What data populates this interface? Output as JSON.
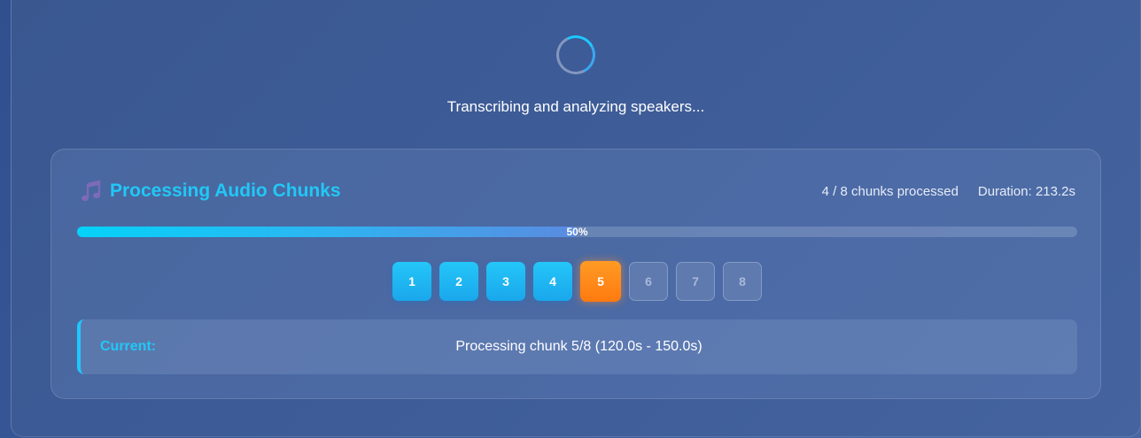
{
  "status": {
    "message": "Transcribing and analyzing speakers..."
  },
  "panel": {
    "title": "Processing Audio Chunks",
    "title_icon": "music-note-icon",
    "chunks_processed": "4 / 8 chunks processed",
    "duration": "Duration: 213.2s",
    "progress": {
      "percent": 50,
      "label": "50%"
    },
    "chunks": [
      {
        "label": "1",
        "state": "done"
      },
      {
        "label": "2",
        "state": "done"
      },
      {
        "label": "3",
        "state": "done"
      },
      {
        "label": "4",
        "state": "done"
      },
      {
        "label": "5",
        "state": "active"
      },
      {
        "label": "6",
        "state": "pending"
      },
      {
        "label": "7",
        "state": "pending"
      },
      {
        "label": "8",
        "state": "pending"
      }
    ],
    "current": {
      "label": "Current:",
      "value": "Processing chunk 5/8 (120.0s - 150.0s)"
    }
  },
  "colors": {
    "accent": "#21c8f6",
    "active_chunk": "#ff8a1a",
    "background": "#3a5790"
  }
}
